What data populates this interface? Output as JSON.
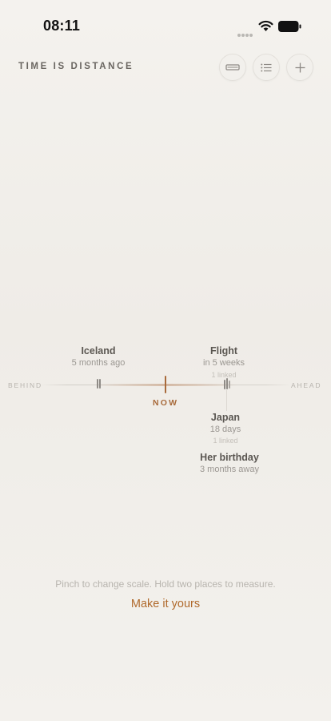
{
  "status_bar": {
    "time": "08:11",
    "icons": [
      "signal-dots-icon",
      "wifi-icon",
      "battery-icon"
    ]
  },
  "header": {
    "title": "TIME IS DISTANCE",
    "buttons": [
      {
        "icon": "ruler-icon"
      },
      {
        "icon": "list-icon"
      },
      {
        "icon": "plus-icon"
      }
    ]
  },
  "timeline": {
    "behind_label": "BEHIND",
    "ahead_label": "AHEAD",
    "now_label": "NOW",
    "events": [
      {
        "title": "Iceland",
        "subtitle": "5 months ago",
        "linked": ""
      },
      {
        "title": "Flight",
        "subtitle": "in 5 weeks",
        "linked": "1 linked"
      },
      {
        "title": "Japan",
        "subtitle": "18 days",
        "linked": "1 linked"
      },
      {
        "title": "Her birthday",
        "subtitle": "3 months away",
        "linked": ""
      }
    ]
  },
  "footer": {
    "hint": "Pinch to change scale. Hold two places to measure.",
    "cta": "Make it yours"
  },
  "colors": {
    "accent": "#a86a3a",
    "cta": "#b06a2c",
    "background": "#f1efeb",
    "text": "#5b5752",
    "muted": "#9b9792"
  }
}
